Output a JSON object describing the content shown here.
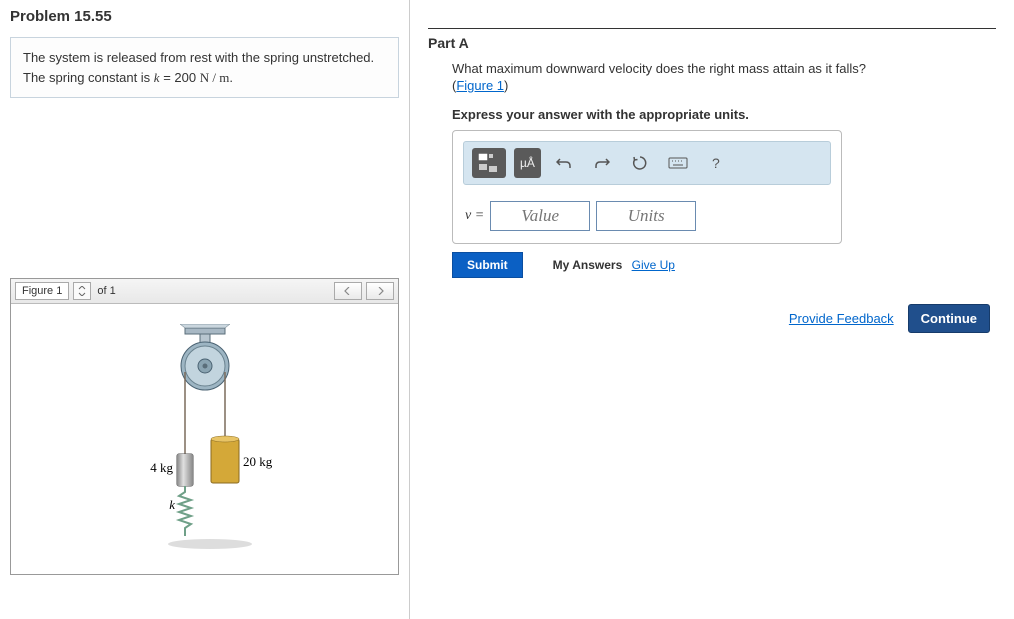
{
  "problem": {
    "title": "Problem 15.55",
    "statement_part1": "The system is released from rest with the spring unstretched. The spring constant is ",
    "k_var": "k",
    "equals": " = 200 ",
    "units_expr": "N / m",
    "period": "."
  },
  "figure": {
    "label": "Figure 1",
    "count_text": "of 1",
    "mass_left": "4 kg",
    "mass_right": "20 kg",
    "spring_label": "k"
  },
  "part": {
    "label": "Part A",
    "question": "What maximum downward velocity does the right mass attain as it falls?",
    "figure_link": "Figure 1",
    "instruction": "Express your answer with the appropriate units.",
    "toolbar": {
      "units_btn": "µÅ",
      "help": "?"
    },
    "input": {
      "var_label": "v =",
      "value_placeholder": "Value",
      "units_placeholder": "Units"
    },
    "submit": "Submit",
    "my_answers": "My Answers",
    "give_up": "Give Up"
  },
  "footer": {
    "provide_feedback": "Provide Feedback",
    "continue": "Continue"
  }
}
